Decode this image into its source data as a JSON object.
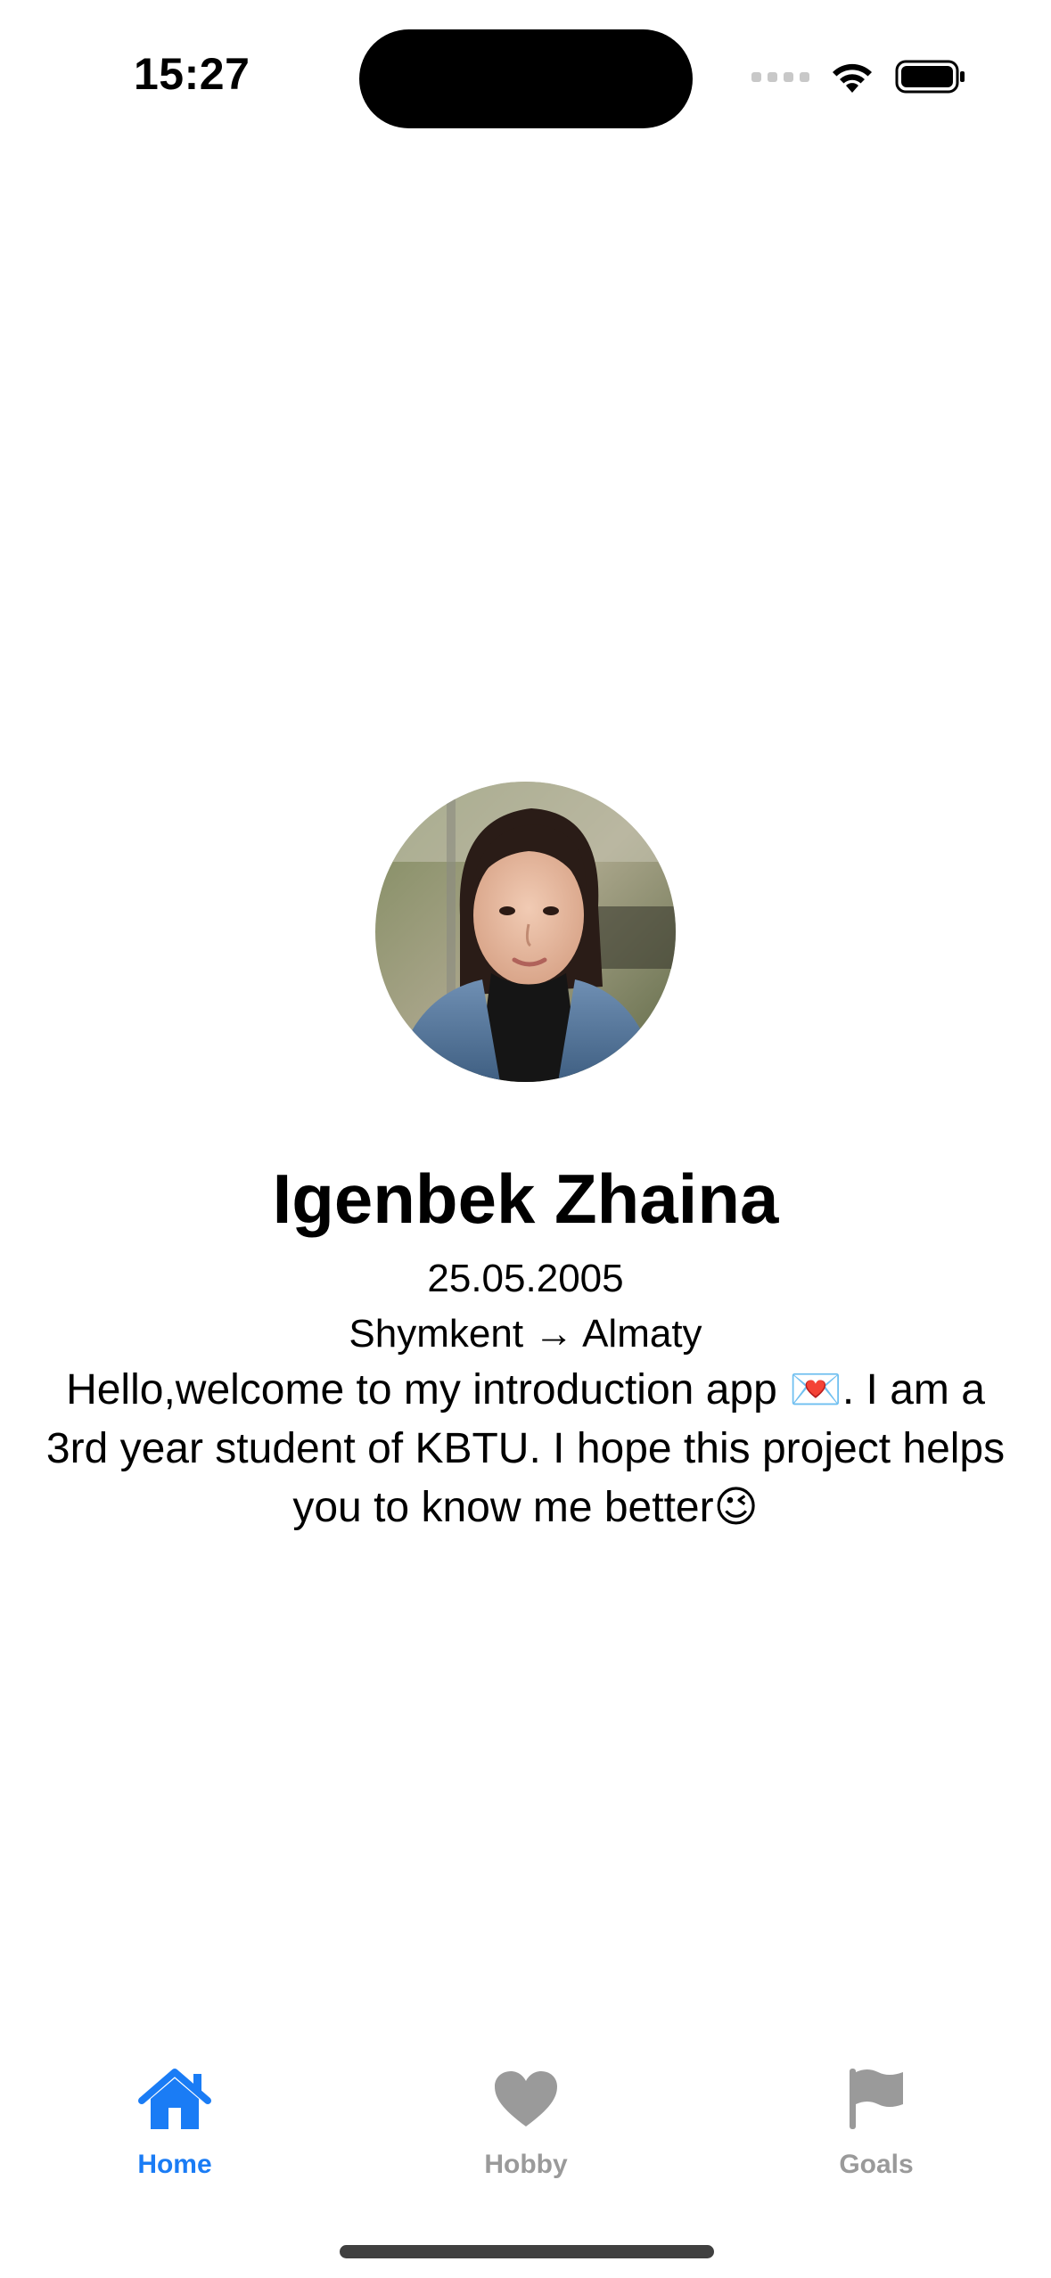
{
  "status_bar": {
    "time": "15:27"
  },
  "profile": {
    "name": "Igenbek Zhaina",
    "birthdate": "25.05.2005",
    "route": "Shymkent → Almaty",
    "bio": "Hello,welcome to my introduction app 💌. I am a 3rd year student of KBTU. I hope this project helps you to know me better😉",
    "avatar_icon": "profile-photo"
  },
  "tab_bar": {
    "active_color": "#1a7cf5",
    "inactive_color": "#9a9a9a",
    "tabs": [
      {
        "label": "Home",
        "icon": "house-icon",
        "active": true
      },
      {
        "label": "Hobby",
        "icon": "heart-icon",
        "active": false
      },
      {
        "label": "Goals",
        "icon": "flag-icon",
        "active": false
      }
    ]
  }
}
